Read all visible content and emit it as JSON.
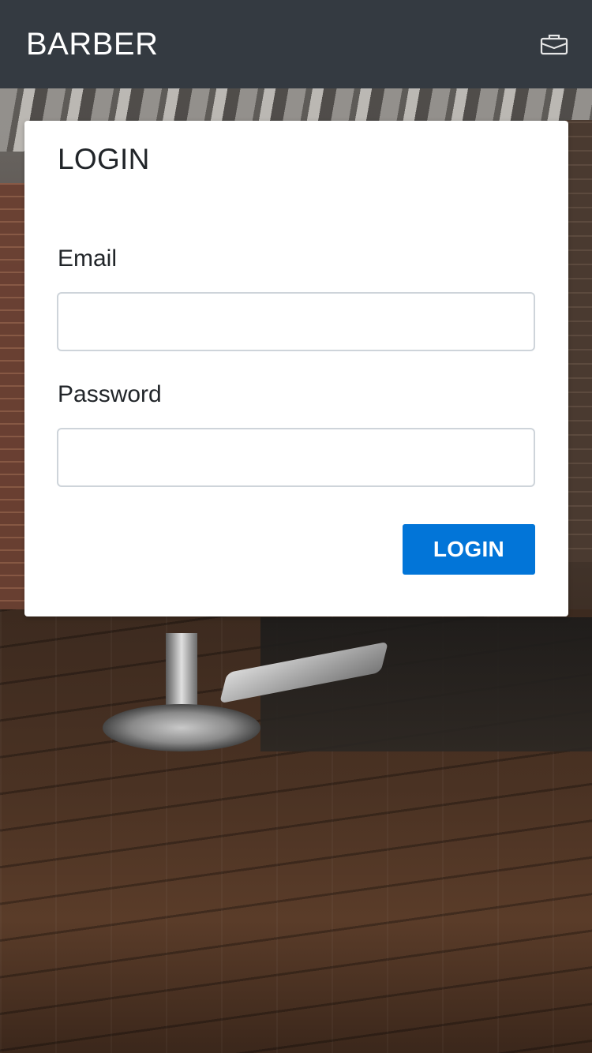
{
  "appbar": {
    "title": "BARBER",
    "icon": "briefcase-icon"
  },
  "login_form": {
    "title": "LOGIN",
    "email": {
      "label": "Email",
      "value": "",
      "placeholder": ""
    },
    "password": {
      "label": "Password",
      "value": "",
      "placeholder": ""
    },
    "submit_label": "LOGIN"
  },
  "colors": {
    "appbar_bg": "#343a41",
    "primary": "#0275d8",
    "card_bg": "#ffffff",
    "text": "#212529",
    "input_border": "#ced4da"
  }
}
